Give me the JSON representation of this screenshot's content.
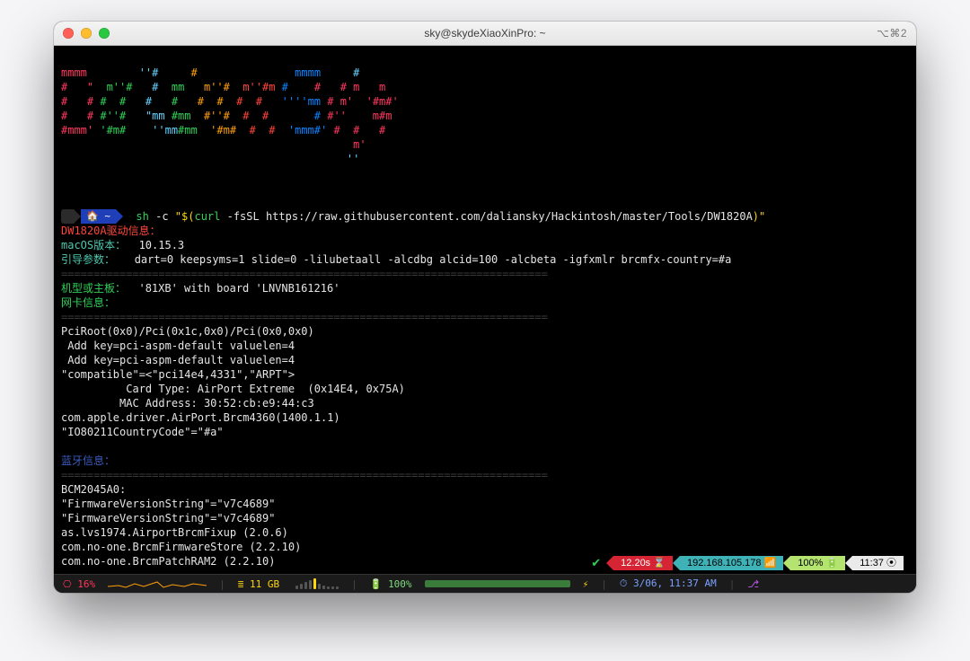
{
  "window": {
    "title": "sky@skydeXiaoXinPro: ~",
    "shortcut": "⌥⌘2"
  },
  "banner_lines": [
    [
      [
        "m",
        "mmmm"
      ],
      [
        "g",
        "        "
      ],
      [
        "c",
        "''#"
      ],
      [
        "g",
        "   "
      ],
      [
        "or",
        "  #"
      ],
      [
        "r",
        "               "
      ],
      [
        "b",
        "mmmm"
      ],
      [
        "y",
        "     "
      ],
      [
        "c",
        "#"
      ]
    ],
    [
      [
        "m",
        "#   \""
      ],
      [
        "g",
        "  m''#"
      ],
      [
        "c",
        "   #"
      ],
      [
        "g",
        "  mm   "
      ],
      [
        "or",
        "m''#"
      ],
      [
        "r",
        "  m''#m"
      ],
      [
        "b",
        " #    "
      ],
      [
        "m",
        "#   # m   m"
      ]
    ],
    [
      [
        "m",
        "#   #"
      ],
      [
        "g",
        " #  #"
      ],
      [
        "c",
        "   #"
      ],
      [
        "g",
        "   #   "
      ],
      [
        "or",
        "#  #"
      ],
      [
        "r",
        "  #  # "
      ],
      [
        "b",
        "  ''''mm"
      ],
      [
        "m",
        " # m'  '#m#'"
      ]
    ],
    [
      [
        "m",
        "#   #"
      ],
      [
        "g",
        " #''#"
      ],
      [
        "c",
        "   \"mm "
      ],
      [
        "g",
        "#mm  "
      ],
      [
        "or",
        "#''#"
      ],
      [
        "r",
        "  #  # "
      ],
      [
        "b",
        "      # "
      ],
      [
        "m",
        "#''    m#m"
      ]
    ],
    [
      [
        "m",
        "#mmm'"
      ],
      [
        "g",
        " '#m#"
      ],
      [
        "c",
        "    ''mm"
      ],
      [
        "g",
        "#mm  "
      ],
      [
        "or",
        "'#m#"
      ],
      [
        "r",
        "  #  # "
      ],
      [
        "b",
        " 'mmm#' "
      ],
      [
        "m",
        "#  #   #"
      ]
    ],
    [
      [
        "m",
        "                                             "
      ],
      [
        "m",
        "m'"
      ]
    ],
    [
      [
        "c",
        "                                            ''"
      ]
    ]
  ],
  "prompt": {
    "apple": "",
    "home": "🏠",
    "tilde": "~"
  },
  "cmd": {
    "sh": "sh",
    "dashc": "-c",
    "q1": "\"$(",
    "curl": "curl",
    "flags": " -fsSL https://raw.githubusercontent.com/daliansky/Hackintosh/master/Tools/DW1820A",
    "q2": ")\""
  },
  "labels": {
    "driver_info": "DW1820A驱动信息：",
    "macos_version_label": "macOS版本：",
    "macos_version_value": "  10.15.3",
    "boot_args_label": "引导参数：",
    "boot_args_value": "   dart=0 keepsyms=1 slide=0 -lilubetaall -alcdbg alcid=100 -alcbeta -igfxmlr brcmfx-country=#a",
    "model_label": "机型或主板：",
    "model_value": "  '81XB' with board 'LNVNB161216'",
    "nic_label": "网卡信息：",
    "bt_label": "蓝牙信息："
  },
  "sep_line": "===========================================================================",
  "body": [
    "PciRoot(0x0)/Pci(0x1c,0x0)/Pci(0x0,0x0)",
    " Add key=pci-aspm-default valuelen=4",
    " Add key=pci-aspm-default valuelen=4",
    "\"compatible\"=<\"pci14e4,4331\",\"ARPT\">",
    "          Card Type: AirPort Extreme  (0x14E4, 0x75A)",
    "         MAC Address: 30:52:cb:e9:44:c3",
    "com.apple.driver.AirPort.Brcm4360(1400.1.1)",
    "\"IO80211CountryCode\"=\"#a\""
  ],
  "bt_body": [
    "BCM2045A0:",
    "\"FirmwareVersionString\"=\"v7c4689\"",
    "\"FirmwareVersionString\"=\"v7c4689\"",
    "as.lvs1974.AirportBrcmFixup (2.0.6)",
    "com.no-one.BrcmFirmwareStore (2.2.10)",
    "com.no-one.BrcmPatchRAM2 (2.2.10)"
  ],
  "rstat": {
    "check": "✔",
    "time": "12.20s",
    "hourglass": "⌛",
    "ip": "192.168.105.178",
    "wifi": "📶",
    "bat": "100%",
    "bat_icon": "🔋",
    "clock": "11:37",
    "clock_icon": "⦿"
  },
  "sysbar": {
    "cpu_icon": "⎔",
    "cpu": "16%",
    "mem_icon": "≣",
    "mem": "11 GB",
    "bat_icon": "🔋",
    "bat": "100%",
    "charge_icon": "⚡",
    "time_icon": "⏱",
    "time": "3/06, 11:37 AM",
    "git_icon": "⎇"
  }
}
